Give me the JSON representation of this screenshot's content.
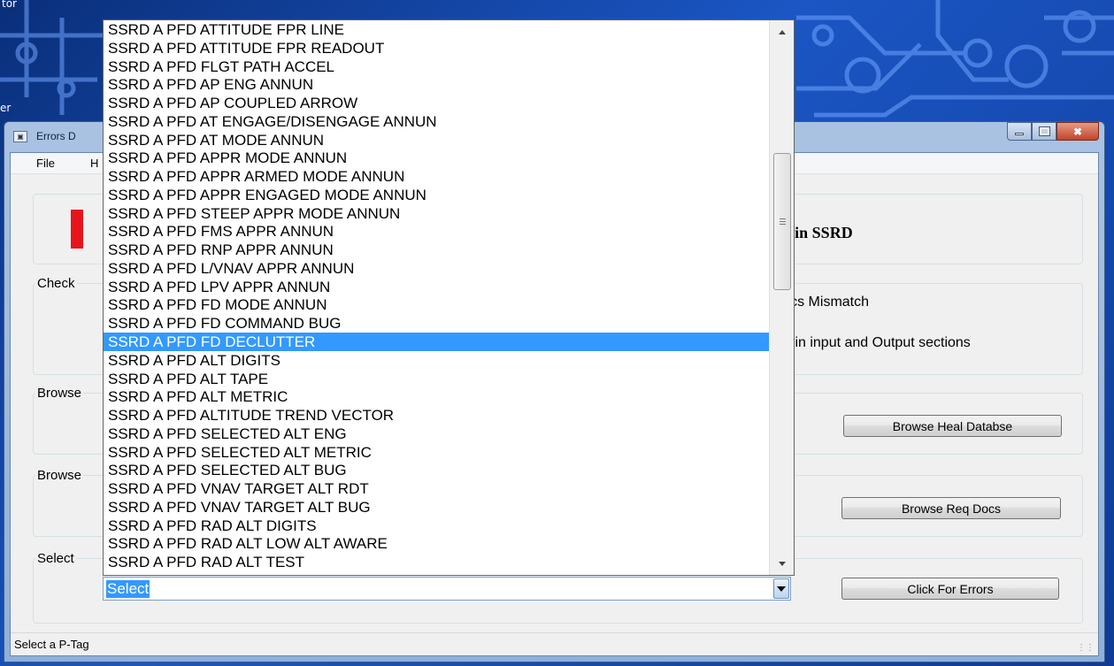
{
  "desktop": {
    "top_label": "tor",
    "side_label": "er"
  },
  "window": {
    "title": "Errors D",
    "menu": {
      "file": "File",
      "help": "H"
    },
    "banner": {
      "text": "r in SSRD",
      "accent_color": "#e8141c"
    },
    "check_group": {
      "label": "Check",
      "option1": "lics Mismatch",
      "option2": "s in input and Output sections"
    },
    "browse_heal_group": {
      "label": "Browse",
      "button": "Browse Heal Databse"
    },
    "browse_req_group": {
      "label": "Browse",
      "button": "Browse Req Docs"
    },
    "select_group": {
      "label": "Select",
      "button": "Click For Errors"
    },
    "combo": {
      "value": "Select"
    },
    "status": "Select a P-Tag"
  },
  "dropdown": {
    "selected_index": 17,
    "items": [
      "SSRD A PFD ATTITUDE FPR LINE",
      "SSRD A PFD ATTITUDE FPR READOUT",
      "SSRD A PFD FLGT PATH ACCEL",
      "SSRD A PFD AP ENG ANNUN",
      "SSRD A PFD AP COUPLED ARROW",
      "SSRD A PFD AT ENGAGE/DISENGAGE ANNUN",
      "SSRD A PFD AT MODE ANNUN",
      "SSRD A PFD APPR MODE ANNUN",
      "SSRD A PFD APPR ARMED MODE ANNUN",
      "SSRD A PFD APPR ENGAGED MODE ANNUN",
      "SSRD A PFD STEEP APPR MODE ANNUN",
      "SSRD A PFD FMS APPR ANNUN",
      "SSRD A PFD RNP APPR ANNUN",
      "SSRD A PFD L/VNAV APPR ANNUN",
      "SSRD A PFD LPV APPR ANNUN",
      "SSRD A PFD FD MODE ANNUN",
      "SSRD A PFD FD COMMAND BUG",
      "SSRD A PFD FD DECLUTTER",
      "SSRD A PFD ALT DIGITS",
      "SSRD A PFD ALT TAPE",
      "SSRD A PFD ALT METRIC",
      "SSRD A PFD ALTITUDE TREND VECTOR",
      "SSRD A PFD SELECTED ALT ENG",
      "SSRD A PFD SELECTED ALT METRIC",
      "SSRD A PFD SELECTED ALT BUG",
      "SSRD A PFD VNAV TARGET ALT RDT",
      "SSRD A PFD VNAV TARGET ALT BUG",
      "SSRD A PFD RAD ALT DIGITS",
      "SSRD A PFD RAD ALT LOW ALT AWARE",
      "SSRD A PFD RAD ALT TEST"
    ]
  }
}
